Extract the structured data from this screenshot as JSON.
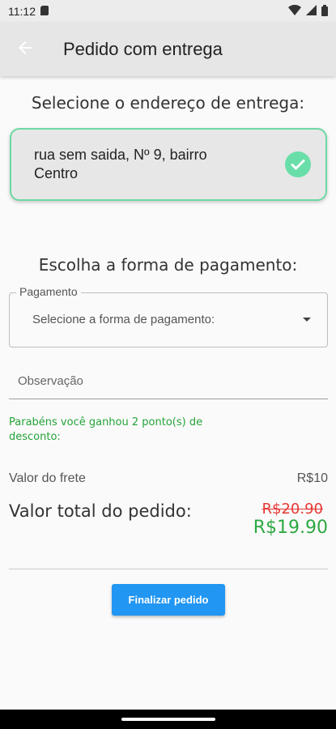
{
  "status_bar": {
    "time": "11:12",
    "icons": [
      "sd-card-icon",
      "wifi-icon",
      "signal-icon",
      "battery-icon"
    ]
  },
  "app_bar": {
    "title": "Pedido com entrega",
    "back_icon": "arrow-back-icon"
  },
  "address": {
    "title": "Selecione o endereço de entrega:",
    "selected": "rua sem saida, Nº 9, bairro Centro",
    "check_icon": "check-circle-icon"
  },
  "payment": {
    "title": "Escolha a forma de pagamento:",
    "field_label": "Pagamento",
    "value": "Selecione a forma de pagamento:"
  },
  "observation": {
    "placeholder": "Observação",
    "value": ""
  },
  "promo": {
    "text": "Parabéns você ganhou 2 ponto(s) de desconto:"
  },
  "summary": {
    "freight_label": "Valor do frete",
    "freight_value": "R$10",
    "total_label": "Valor total do pedido:",
    "old_total": "R$20.90",
    "new_total": "R$19.90"
  },
  "actions": {
    "finish_label": "Finalizar pedido"
  },
  "colors": {
    "primary": "#2196f3",
    "accent_green": "#69dea9",
    "promo_green": "#26a33a",
    "price_red": "#e53935"
  }
}
